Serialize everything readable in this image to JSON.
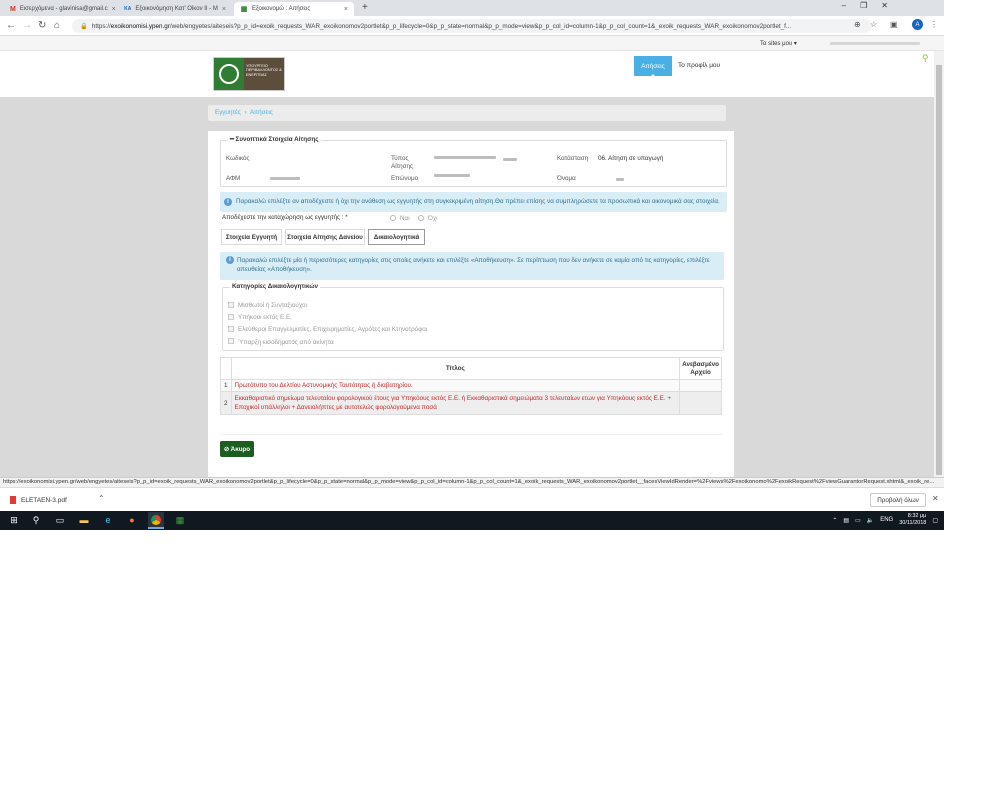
{
  "browser": {
    "tabs": [
      {
        "title": "Εισερχόμενα - glavinisa@gmail.c",
        "icon": "M"
      },
      {
        "title": "Εξοικονόμηση Κατ' Οίκον ΙΙ - Μ",
        "icon": "ΚΑ"
      },
      {
        "title": "Εξοικονομώ : Αιτήσεις",
        "icon": "▦"
      }
    ],
    "new_tab": "+",
    "url_host": "exoikonomisi.ypen.gr",
    "url_path": "/web/engyetes/aiteseis?p_p_id=exoik_requests_WAR_exoikonomov2portlet&p_p_lifecycle=0&p_p_state=normal&p_p_mode=view&p_p_col_id=column-1&p_p_col_count=1&_exoik_requests_WAR_exoikonomov2portlet_f...",
    "profile_initial": "A"
  },
  "site": {
    "sites_link": "Τα sites μου ▾",
    "logo_text": "ΥΠΟΥΡΓΕΙΟ ΠΕΡΙΒΑΛΛΟΝΤΟΣ & ΕΝΕΡΓΕΙΑΣ",
    "nav": {
      "aitiseis": "Αιτήσεις",
      "profile": "Το προφίλ μου"
    }
  },
  "breadcrumb": {
    "item1": "Εγγυητές",
    "sep": "›",
    "item2": "Αιτήσεις"
  },
  "summary": {
    "legend": "━ Συνοπτικά Στοιχεία Αίτησης",
    "kodikos_label": "Κωδικός",
    "typos_label": "Τύπος Αίτησης",
    "katastasi_label": "Κατάσταση",
    "katastasi_value": "06. Αίτηση σε υπαγωγή",
    "afm_label": "ΑΦΜ",
    "eponymo_label": "Επώνυμο",
    "onoma_label": "Όνομα"
  },
  "alert_guarantor": "Παρακαλώ επιλέξτε αν αποδέχεστε ή όχι την ανάθεση ως εγγυητής στη συγκεκριμένη αίτηση.Θα πρέπει επίσης να συμπληρώσετε τα προσωπικά και οικονομικά σας στοιχεία.",
  "accept": {
    "label": "Αποδέχεστε την καταχώρηση ως εγγυητής : *",
    "yes": "Ναι",
    "no": "Όχι"
  },
  "tabs": {
    "guarantor": "Στοιχεία Εγγυητή",
    "loan": "Στοιχεία Αίτησης Δανείου",
    "docs": "Δικαιολογητικά"
  },
  "alert_categories": "Παρακαλώ επιλέξτε μία ή περισσότερες κατηγορίες στις οποίες ανήκετε και επιλέξτε «Αποθήκευση». Σε περίπτωση που δεν ανήκετε σε καμία από τις κατηγορίες, επιλέξτε απευθείας «Αποθήκευση».",
  "categories": {
    "legend": "Κατηγορίες Δικαιολογητικών",
    "items": [
      "Μισθωτοί ή Συνταξιούχοι",
      "Υπήκοοι εκτός Ε.Ε.",
      "Ελεύθεροι Επαγγελματίες, Επιχειρηματίες, Αγρότες και Κτηνοτρόφοι",
      "Ύπαρξη εισοδήματος από ακίνητα"
    ]
  },
  "doc_table": {
    "col_title": "Τίτλος",
    "col_file": "Ανεβασμένο Αρχείο",
    "rows": [
      {
        "num": "1",
        "title": "Πρωτότυπο του Δελτίου Αστυνομικής Ταυτότητας ή διαβατηρίου."
      },
      {
        "num": "2",
        "title": "Εκκαθαριστικό σημείωμα τελευταίου φορολογικού έτους για Υπηκόους εκτός Ε.Ε. ή Εκκαθαριστικά σημειώματα 3 τελευταίων ετων για Υπηκόους εκτός Ε.Ε. + Εποχικοί υπάλληλοι + Δανειολήπτες με αυτοτελώς φορολογούμενα ποσά"
      }
    ]
  },
  "cancel_button": "⊘ Άκυρο",
  "status_url": "https://exoikonomisi.ypen.gr/web/engyetes/aiteseis?p_p_id=exoik_requests_WAR_exoikonomov2portlet&p_p_lifecycle=0&p_p_state=normal&p_p_mode=view&p_p_col_id=column-1&p_p_col_count=1&_exoik_requests_WAR_exoikonomov2portlet__facesViewIdRender=%2Fviews%2Fexoikonomo%2FexoikRequest%2FviewGuarantorRequest.xhtml&_exoik_re...",
  "download": {
    "filename": "ELETAEN-3.pdf",
    "show_all": "Προβολή όλων"
  },
  "taskbar": {
    "lang": "ENG",
    "time": "8:32 μμ",
    "date": "30/11/2018"
  }
}
